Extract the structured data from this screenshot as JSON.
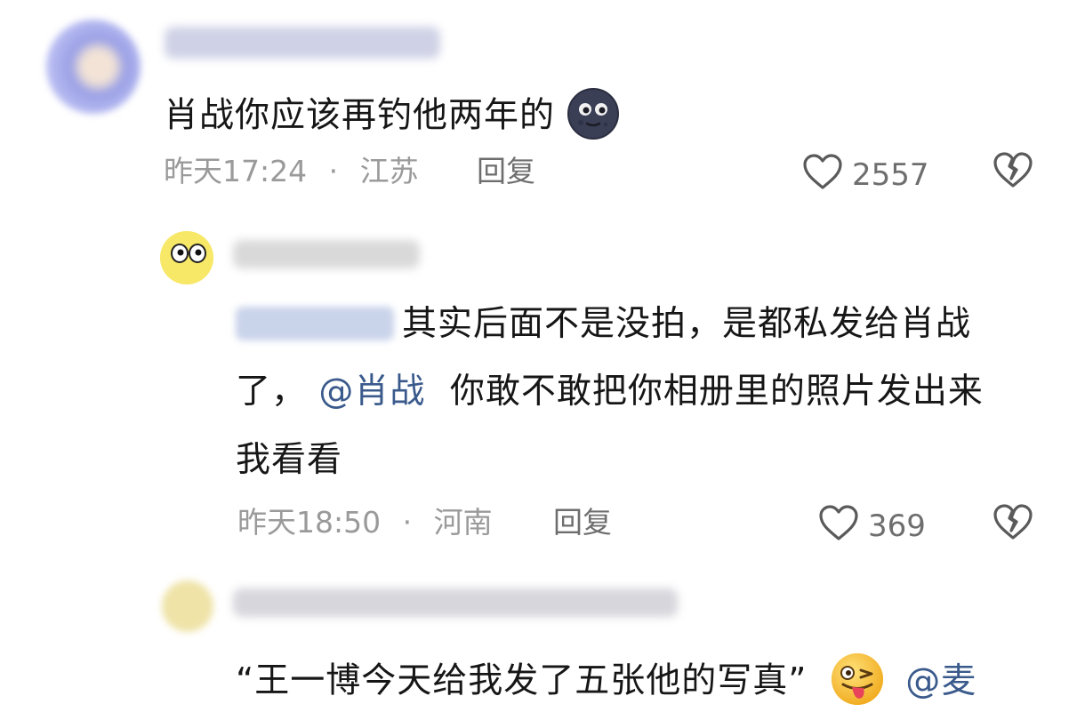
{
  "comments": [
    {
      "text": "肖战你应该再钓他两年的",
      "emoji": "new-moon-face",
      "time": "昨天17:24",
      "sep": "·",
      "location": "江苏",
      "reply_label": "回复",
      "likes": "2557"
    },
    {
      "line1": "其实后面不是没拍，是都私发给肖战",
      "line2_prefix": "了，",
      "mention": "@肖战",
      "line2_rest": "你敢不敢把你相册里的照片发出来",
      "line3": "我看看",
      "time": "昨天18:50",
      "sep": "·",
      "location": "河南",
      "reply_label": "回复",
      "likes": "369"
    },
    {
      "text": "“王一博今天给我发了五张他的写真”",
      "emoji": "winking-tongue-face",
      "mention": "@麦"
    }
  ],
  "colors": {
    "mention": "#3a5a8c",
    "meta": "#9a9a9a",
    "text": "#161616"
  }
}
